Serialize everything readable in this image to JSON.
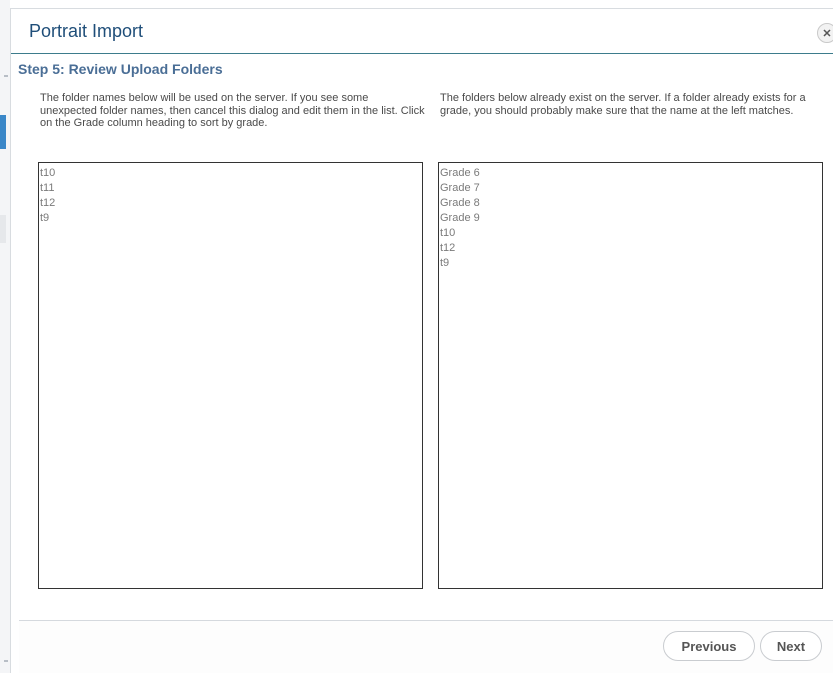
{
  "dialog": {
    "title": "Portrait Import",
    "close_icon": "close-icon"
  },
  "step": {
    "title": "Step 5: Review Upload Folders"
  },
  "left_panel": {
    "instructions": "The folder names below will be used on the server. If you see some unexpected folder names, then cancel this dialog and edit them in the list. Click on the Grade column heading to sort by grade.",
    "items": [
      "t10",
      "t11",
      "t12",
      "t9"
    ]
  },
  "right_panel": {
    "instructions": "The folders below already exist on the server. If a folder already exists for a grade, you should probably make sure that the name at the left matches.",
    "items": [
      "Grade 6",
      "Grade 7",
      "Grade 8",
      "Grade 9",
      "t10",
      "t12",
      "t9"
    ]
  },
  "footer": {
    "previous_label": "Previous",
    "next_label": "Next"
  }
}
